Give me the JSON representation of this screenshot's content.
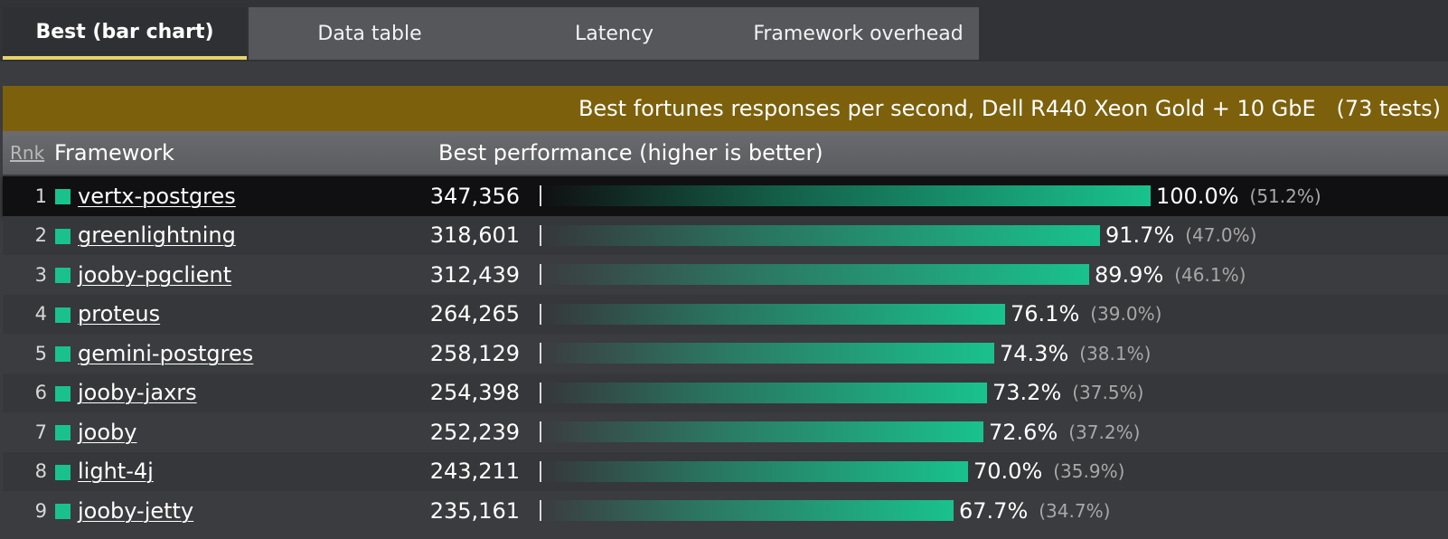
{
  "tabs": [
    {
      "label": "Best (bar chart)"
    },
    {
      "label": "Data table"
    },
    {
      "label": "Latency"
    },
    {
      "label": "Framework overhead"
    }
  ],
  "title": "Best fortunes responses per second, Dell R440 Xeon Gold + 10 GbE   (73 tests)",
  "headers": {
    "rank": "Rnk",
    "framework": "Framework",
    "performance": "Best performance (higher is better)"
  },
  "colors": {
    "accent": "#19c28d",
    "title_bar": "#7c600c",
    "active_tab_underline": "#e6d36a"
  },
  "rows": [
    {
      "rank": "1",
      "name": "vertx-postgres",
      "rps": "347,356",
      "pct": "100.0%",
      "sub": "(51.2%)",
      "share": 1.0
    },
    {
      "rank": "2",
      "name": "greenlightning",
      "rps": "318,601",
      "pct": "91.7%",
      "sub": "(47.0%)",
      "share": 0.917
    },
    {
      "rank": "3",
      "name": "jooby-pgclient",
      "rps": "312,439",
      "pct": "89.9%",
      "sub": "(46.1%)",
      "share": 0.899
    },
    {
      "rank": "4",
      "name": "proteus",
      "rps": "264,265",
      "pct": "76.1%",
      "sub": "(39.0%)",
      "share": 0.761
    },
    {
      "rank": "5",
      "name": "gemini-postgres",
      "rps": "258,129",
      "pct": "74.3%",
      "sub": "(38.1%)",
      "share": 0.743
    },
    {
      "rank": "6",
      "name": "jooby-jaxrs",
      "rps": "254,398",
      "pct": "73.2%",
      "sub": "(37.5%)",
      "share": 0.732
    },
    {
      "rank": "7",
      "name": "jooby",
      "rps": "252,239",
      "pct": "72.6%",
      "sub": "(37.2%)",
      "share": 0.726
    },
    {
      "rank": "8",
      "name": "light-4j",
      "rps": "243,211",
      "pct": "70.0%",
      "sub": "(35.9%)",
      "share": 0.7
    },
    {
      "rank": "9",
      "name": "jooby-jetty",
      "rps": "235,161",
      "pct": "67.7%",
      "sub": "(34.7%)",
      "share": 0.677
    }
  ]
}
